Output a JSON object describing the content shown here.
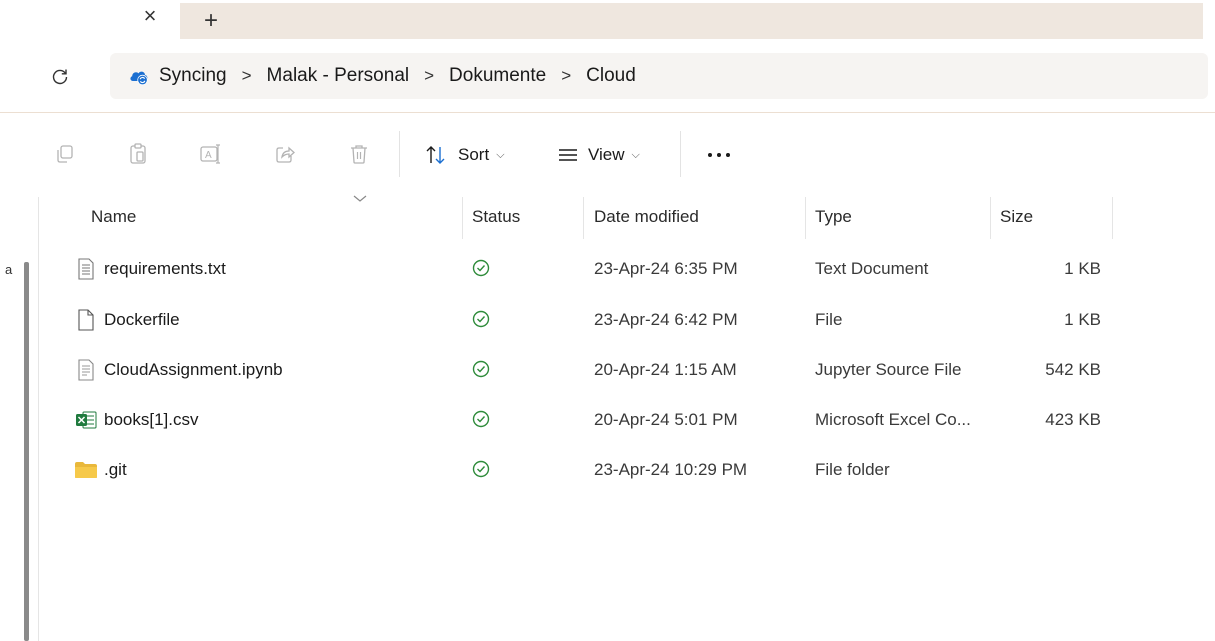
{
  "tabs": {
    "close_glyph": "×",
    "new_tab_glyph": "+"
  },
  "address": {
    "breadcrumbs": [
      "Syncing",
      "Malak - Personal",
      "Dokumente",
      "Cloud"
    ],
    "separator": ">"
  },
  "toolbar": {
    "sort_label": "Sort",
    "view_label": "View",
    "icons": [
      "copy-icon",
      "paste-icon",
      "rename-icon",
      "share-icon",
      "delete-icon",
      "sort-icon",
      "view-icon",
      "more-icon"
    ]
  },
  "left_rail": {
    "stub_text": "a"
  },
  "columns": {
    "name": "Name",
    "status": "Status",
    "date": "Date modified",
    "type": "Type",
    "size": "Size"
  },
  "files": [
    {
      "name": "requirements.txt",
      "status": "synced",
      "date": "23-Apr-24 6:35 PM",
      "type": "Text Document",
      "size": "1 KB",
      "icon": "text-file-icon"
    },
    {
      "name": "Dockerfile",
      "status": "synced",
      "date": "23-Apr-24 6:42 PM",
      "type": "File",
      "size": "1 KB",
      "icon": "blank-file-icon"
    },
    {
      "name": "CloudAssignment.ipynb",
      "status": "synced",
      "date": "20-Apr-24 1:15 AM",
      "type": "Jupyter Source File",
      "size": "542 KB",
      "icon": "notebook-file-icon"
    },
    {
      "name": "books[1].csv",
      "status": "synced",
      "date": "20-Apr-24 5:01 PM",
      "type": "Microsoft Excel Co...",
      "size": "423 KB",
      "icon": "excel-file-icon"
    },
    {
      "name": ".git",
      "status": "synced",
      "date": "23-Apr-24 10:29 PM",
      "type": "File folder",
      "size": "",
      "icon": "folder-icon"
    }
  ],
  "colors": {
    "tab_bar": "#efe7df",
    "status_green": "#2e8b3a",
    "sync_blue": "#1b6fd1",
    "excel_green": "#1f7a3e",
    "folder_yellow": "#f6c94a"
  }
}
